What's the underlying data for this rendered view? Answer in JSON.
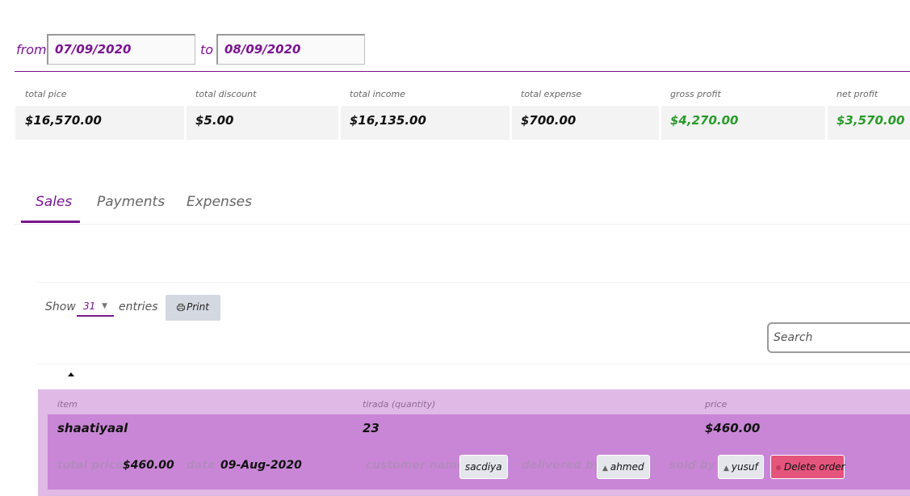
{
  "range": {
    "from_label": "from",
    "from_value": "07/09/2020",
    "to_label": "to",
    "to_value": "08/09/2020"
  },
  "stats": [
    {
      "label": "total pice",
      "value": "$16,570.00"
    },
    {
      "label": "total discount",
      "value": "$5.00"
    },
    {
      "label": "total income",
      "value": "$16,135.00"
    },
    {
      "label": "total expense",
      "value": "$700.00"
    },
    {
      "label": "gross profit",
      "value": "$4,270.00"
    },
    {
      "label": "net profit",
      "value": "$3,570.00"
    }
  ],
  "colors": {
    "accent": "#7a1591",
    "profit": "#2a9a2a",
    "row_outer": "#e0b9e6",
    "row_inner": "#c986d6",
    "delete": "#e4547c"
  },
  "tabs": [
    {
      "label": "Sales",
      "active": true
    },
    {
      "label": "Payments",
      "active": false
    },
    {
      "label": "Expenses",
      "active": false
    }
  ],
  "table_controls": {
    "show_label": "Show",
    "entries_value": "31",
    "entries_label": "entries",
    "print_label": "Print",
    "print_icon": "printer-icon",
    "search_placeholder": "Search",
    "sort_icon": "sort-up-icon"
  },
  "order": {
    "headers": {
      "item": "item",
      "quantity": "tirada (quantity)",
      "price": "price"
    },
    "row": {
      "item": "shaatiyaal",
      "quantity": "23",
      "price": "$460.00"
    },
    "details": {
      "total_price_label": "total price",
      "total_price_value": "$460.00",
      "date_label": "date",
      "date_value": "09-Aug-2020",
      "customer_label": "customer name",
      "customer_value": "sacdiya",
      "delivered_label": "delivered by",
      "delivered_value": "ahmed",
      "sold_label": "sold by",
      "sold_value": "yusuf",
      "delete_label": "Delete order"
    }
  }
}
